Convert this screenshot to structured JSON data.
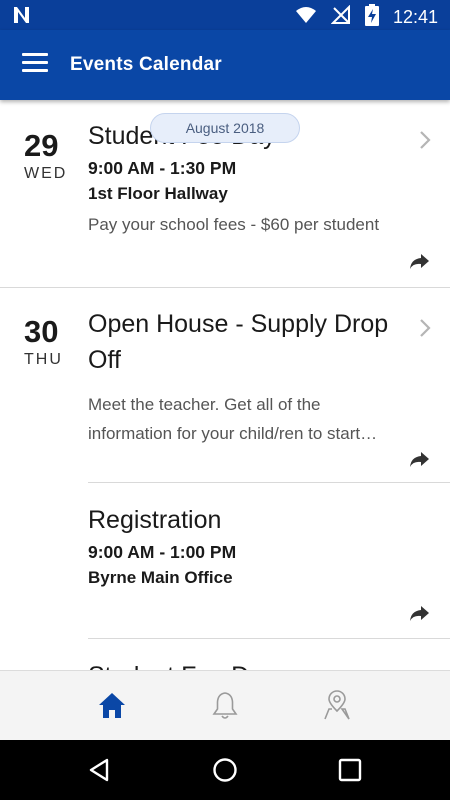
{
  "status_bar": {
    "time": "12:41",
    "icons": [
      "n-notification-icon",
      "wifi-icon",
      "no-signal-icon",
      "battery-charging-icon"
    ]
  },
  "app_bar": {
    "title": "Events Calendar",
    "menu_icon": "hamburger-menu-icon"
  },
  "month_label": "August 2018",
  "days": [
    {
      "number": "29",
      "weekday": "WED",
      "events": [
        {
          "title": "Student Fee Day",
          "time": "9:00 AM - 1:30 PM",
          "location": "1st Floor Hallway",
          "description": "Pay your school fees - $60 per student"
        }
      ]
    },
    {
      "number": "30",
      "weekday": "THU",
      "events": [
        {
          "title_line1": "Open House - Supply Drop",
          "title_line2": "Off",
          "desc_line1": "Meet the teacher. Get all of the",
          "desc_line2": "information for your child/ren to start…"
        },
        {
          "title": "Registration",
          "time": "9:00 AM - 1:00 PM",
          "location": "Byrne Main Office"
        },
        {
          "title": "Student Fee Day"
        }
      ]
    }
  ],
  "bottom_nav": {
    "items": [
      "home-icon",
      "notifications-bell-icon",
      "map-location-icon"
    ],
    "active_color": "#0a47a6",
    "inactive_color": "#9a9a9a"
  },
  "system_nav": {
    "items": [
      "back-icon",
      "home-circle-icon",
      "recents-square-icon"
    ]
  },
  "colors": {
    "primary": "#0a47a6",
    "status_bar": "#0a3f9a"
  }
}
